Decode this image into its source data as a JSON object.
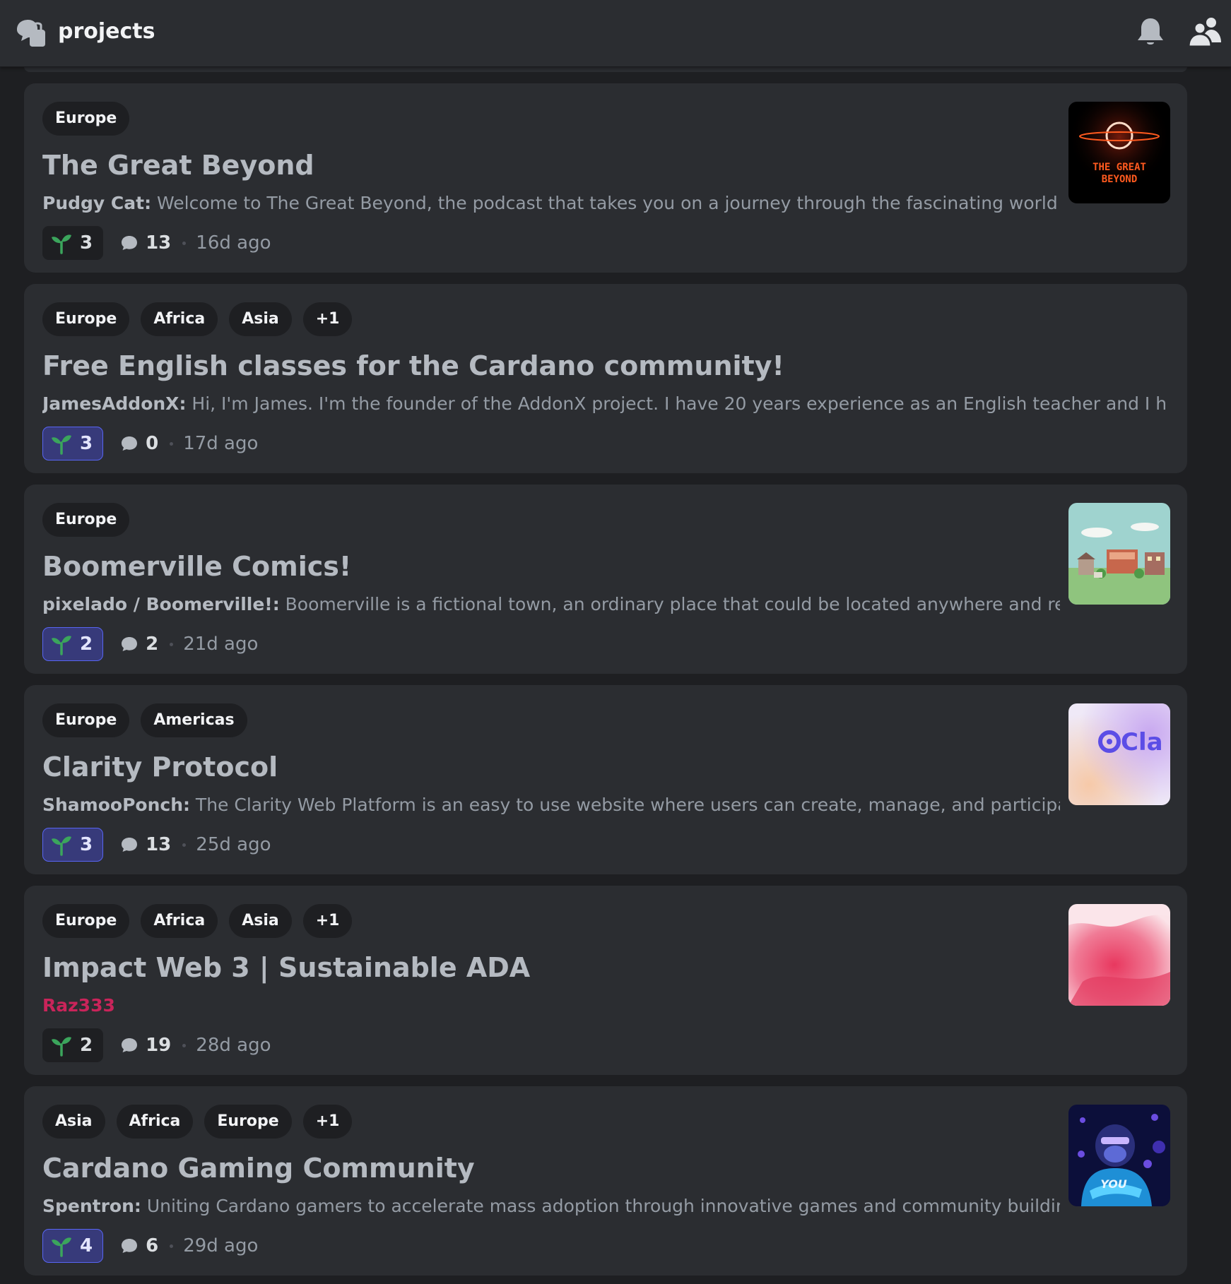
{
  "header": {
    "title": "projects",
    "icons": [
      "forum-icon",
      "bell-icon",
      "members-icon"
    ]
  },
  "posts": [
    {
      "tags": [
        "Europe"
      ],
      "title": "The Great Beyond",
      "author": "Pudgy Cat:",
      "description": " Welcome to The Great Beyond, the podcast that takes you on a journey through the fascinating world of c...",
      "reactions": "3",
      "reacted": false,
      "comments": "13",
      "age": "16d ago",
      "thumbnail": "the-great-beyond-logo",
      "thumbnail_text": [
        "THE GREAT",
        "BEYOND"
      ]
    },
    {
      "tags": [
        "Europe",
        "Africa",
        "Asia",
        "+1"
      ],
      "title": "Free English classes for the Cardano community!",
      "author": "JamesAddonX:",
      "description": " Hi, I'm James. I'm the founder of the AddonX project. I have 20 years experience as an English teacher and I help no...",
      "reactions": "3",
      "reacted": true,
      "comments": "0",
      "age": "17d ago",
      "thumbnail": null
    },
    {
      "tags": [
        "Europe"
      ],
      "title": "Boomerville Comics!",
      "author": "pixelado / Boomerville!:",
      "description": " Boomerville is a fictional town, an ordinary place that could be located anywhere and repres...",
      "reactions": "2",
      "reacted": true,
      "comments": "2",
      "age": "21d ago",
      "thumbnail": "boomerville-town-illustration"
    },
    {
      "tags": [
        "Europe",
        "Americas"
      ],
      "title": "Clarity Protocol",
      "author": "ShamooPonch:",
      "description": " The Clarity Web Platform is an easy to use website where users can create, manage, and participate i...",
      "reactions": "3",
      "reacted": true,
      "comments": "13",
      "age": "25d ago",
      "thumbnail": "clarity-logo",
      "thumbnail_text": [
        "Cla"
      ]
    },
    {
      "tags": [
        "Europe",
        "Africa",
        "Asia",
        "+1"
      ],
      "title": "Impact Web 3 | Sustainable ADA",
      "author": "Raz333",
      "description": "",
      "reactions": "2",
      "reacted": false,
      "comments": "19",
      "age": "28d ago",
      "thumbnail": "pink-watercolor"
    },
    {
      "tags": [
        "Asia",
        "Africa",
        "Europe",
        "+1"
      ],
      "title": "Cardano Gaming Community",
      "author": "Spentron:",
      "description": " Uniting Cardano gamers to accelerate mass adoption through innovative games and community building. O...",
      "reactions": "4",
      "reacted": true,
      "comments": "6",
      "age": "29d ago",
      "thumbnail": "gorilla-gamer-avatar",
      "thumbnail_text": [
        "YOU"
      ]
    }
  ],
  "colors": {
    "background": "#1e1f22",
    "card": "#2b2d31",
    "sprout_green": "#3ba55c",
    "reaction_active_border": "#5865f2",
    "author_highlight": "#c9245a"
  }
}
